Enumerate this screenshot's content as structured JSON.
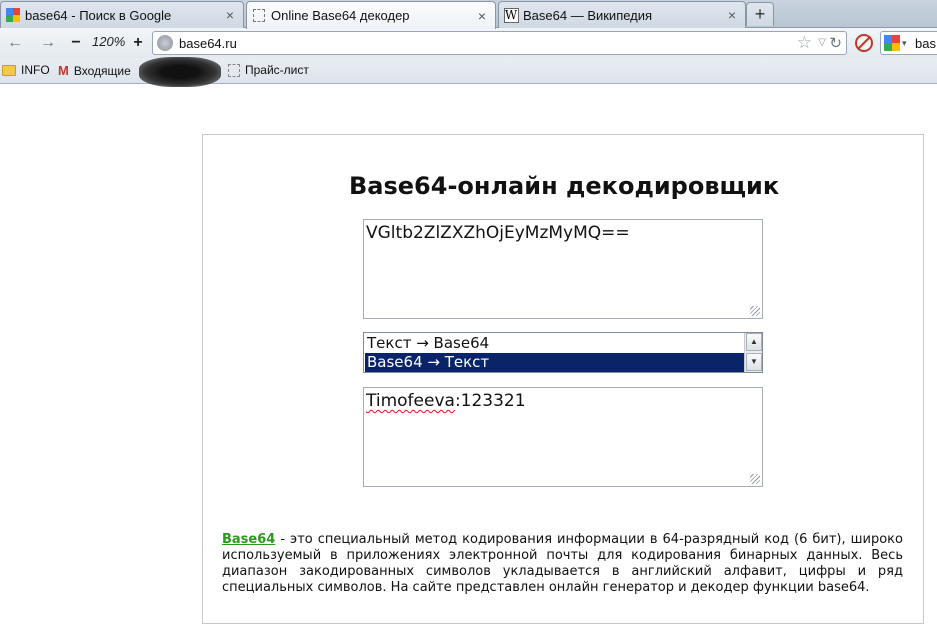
{
  "browser": {
    "tabs": [
      {
        "title": "base64 - Поиск в Google",
        "icon": "google-icon",
        "active": false
      },
      {
        "title": "Online Base64 декодер",
        "icon": "blank-page-icon",
        "active": true
      },
      {
        "title": "Base64 — Википедия",
        "icon": "wikipedia-icon",
        "active": false
      }
    ],
    "new_tab_label": "+",
    "tab_close_label": "×",
    "zoom_level": "120%",
    "zoom_out_label": "−",
    "zoom_in_label": "+",
    "url": "base64.ru",
    "search_text": "bas"
  },
  "bookmarks": [
    {
      "label": "INFO",
      "icon": "folder-icon"
    },
    {
      "label": "Входящие",
      "icon": "gmail-icon"
    },
    {
      "label": "Прайс-лист",
      "icon": "blank-page-icon"
    }
  ],
  "page": {
    "title": "Base64-онлайн декодировщик",
    "input_text": "VGltb2ZlZXZhOjEyMzMyMQ==",
    "mode_options": [
      "Текст → Base64",
      "Base64 → Текст"
    ],
    "selected_mode": "Base64 → Текст",
    "output_user": "Timofeeva",
    "output_rest": ":123321",
    "description": {
      "link_text": "Base64",
      "text": " - это специальный метод кодирования информации в 64-разрядный код (6 бит), широко используемый в приложениях электронной почты для кодирования бинарных данных. Весь диапазон закодированных символов укладывается в английский алфавит, цифры и ряд специальных символов. На сайте представлен онлайн генератор и декодер функции base64."
    }
  },
  "colors": {
    "selection_bg": "#0a246a",
    "link": "#2a9a1d",
    "spellcheck": "#dd1122"
  }
}
